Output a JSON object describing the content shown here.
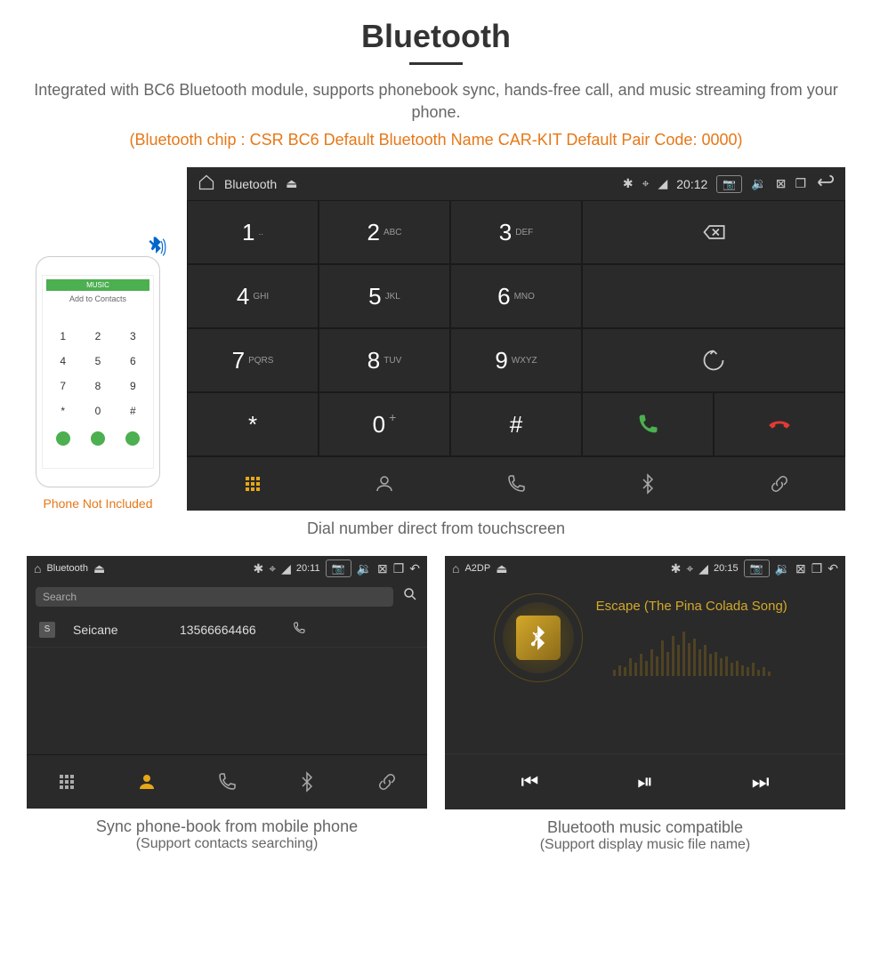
{
  "title": "Bluetooth",
  "subtitle": "Integrated with BC6 Bluetooth module, supports phonebook sync, hands-free call, and music streaming from your phone.",
  "spec_line": "(Bluetooth chip : CSR BC6     Default Bluetooth Name CAR-KIT     Default Pair Code: 0000)",
  "phone": {
    "add_contacts": "Add to Contacts",
    "caption": "Phone Not Included"
  },
  "main_device": {
    "status": {
      "title": "Bluetooth",
      "time": "20:12"
    },
    "keys": [
      {
        "num": "1",
        "let": ".."
      },
      {
        "num": "2",
        "let": "ABC"
      },
      {
        "num": "3",
        "let": "DEF"
      },
      {
        "num": "4",
        "let": "GHI"
      },
      {
        "num": "5",
        "let": "JKL"
      },
      {
        "num": "6",
        "let": "MNO"
      },
      {
        "num": "7",
        "let": "PQRS"
      },
      {
        "num": "8",
        "let": "TUV"
      },
      {
        "num": "9",
        "let": "WXYZ"
      },
      {
        "num": "*",
        "let": ""
      },
      {
        "num": "0",
        "let": "+"
      },
      {
        "num": "#",
        "let": ""
      }
    ],
    "caption": "Dial number direct from touchscreen"
  },
  "phonebook": {
    "status": {
      "title": "Bluetooth",
      "time": "20:11"
    },
    "search_placeholder": "Search",
    "contact": {
      "badge": "S",
      "name": "Seicane",
      "number": "13566664466"
    },
    "caption": "Sync phone-book from mobile phone",
    "caption_sub": "(Support contacts searching)"
  },
  "music": {
    "status": {
      "title": "A2DP",
      "time": "20:15"
    },
    "track": "Escape (The Pina Colada Song)",
    "caption": "Bluetooth music compatible",
    "caption_sub": "(Support display music file name)"
  }
}
